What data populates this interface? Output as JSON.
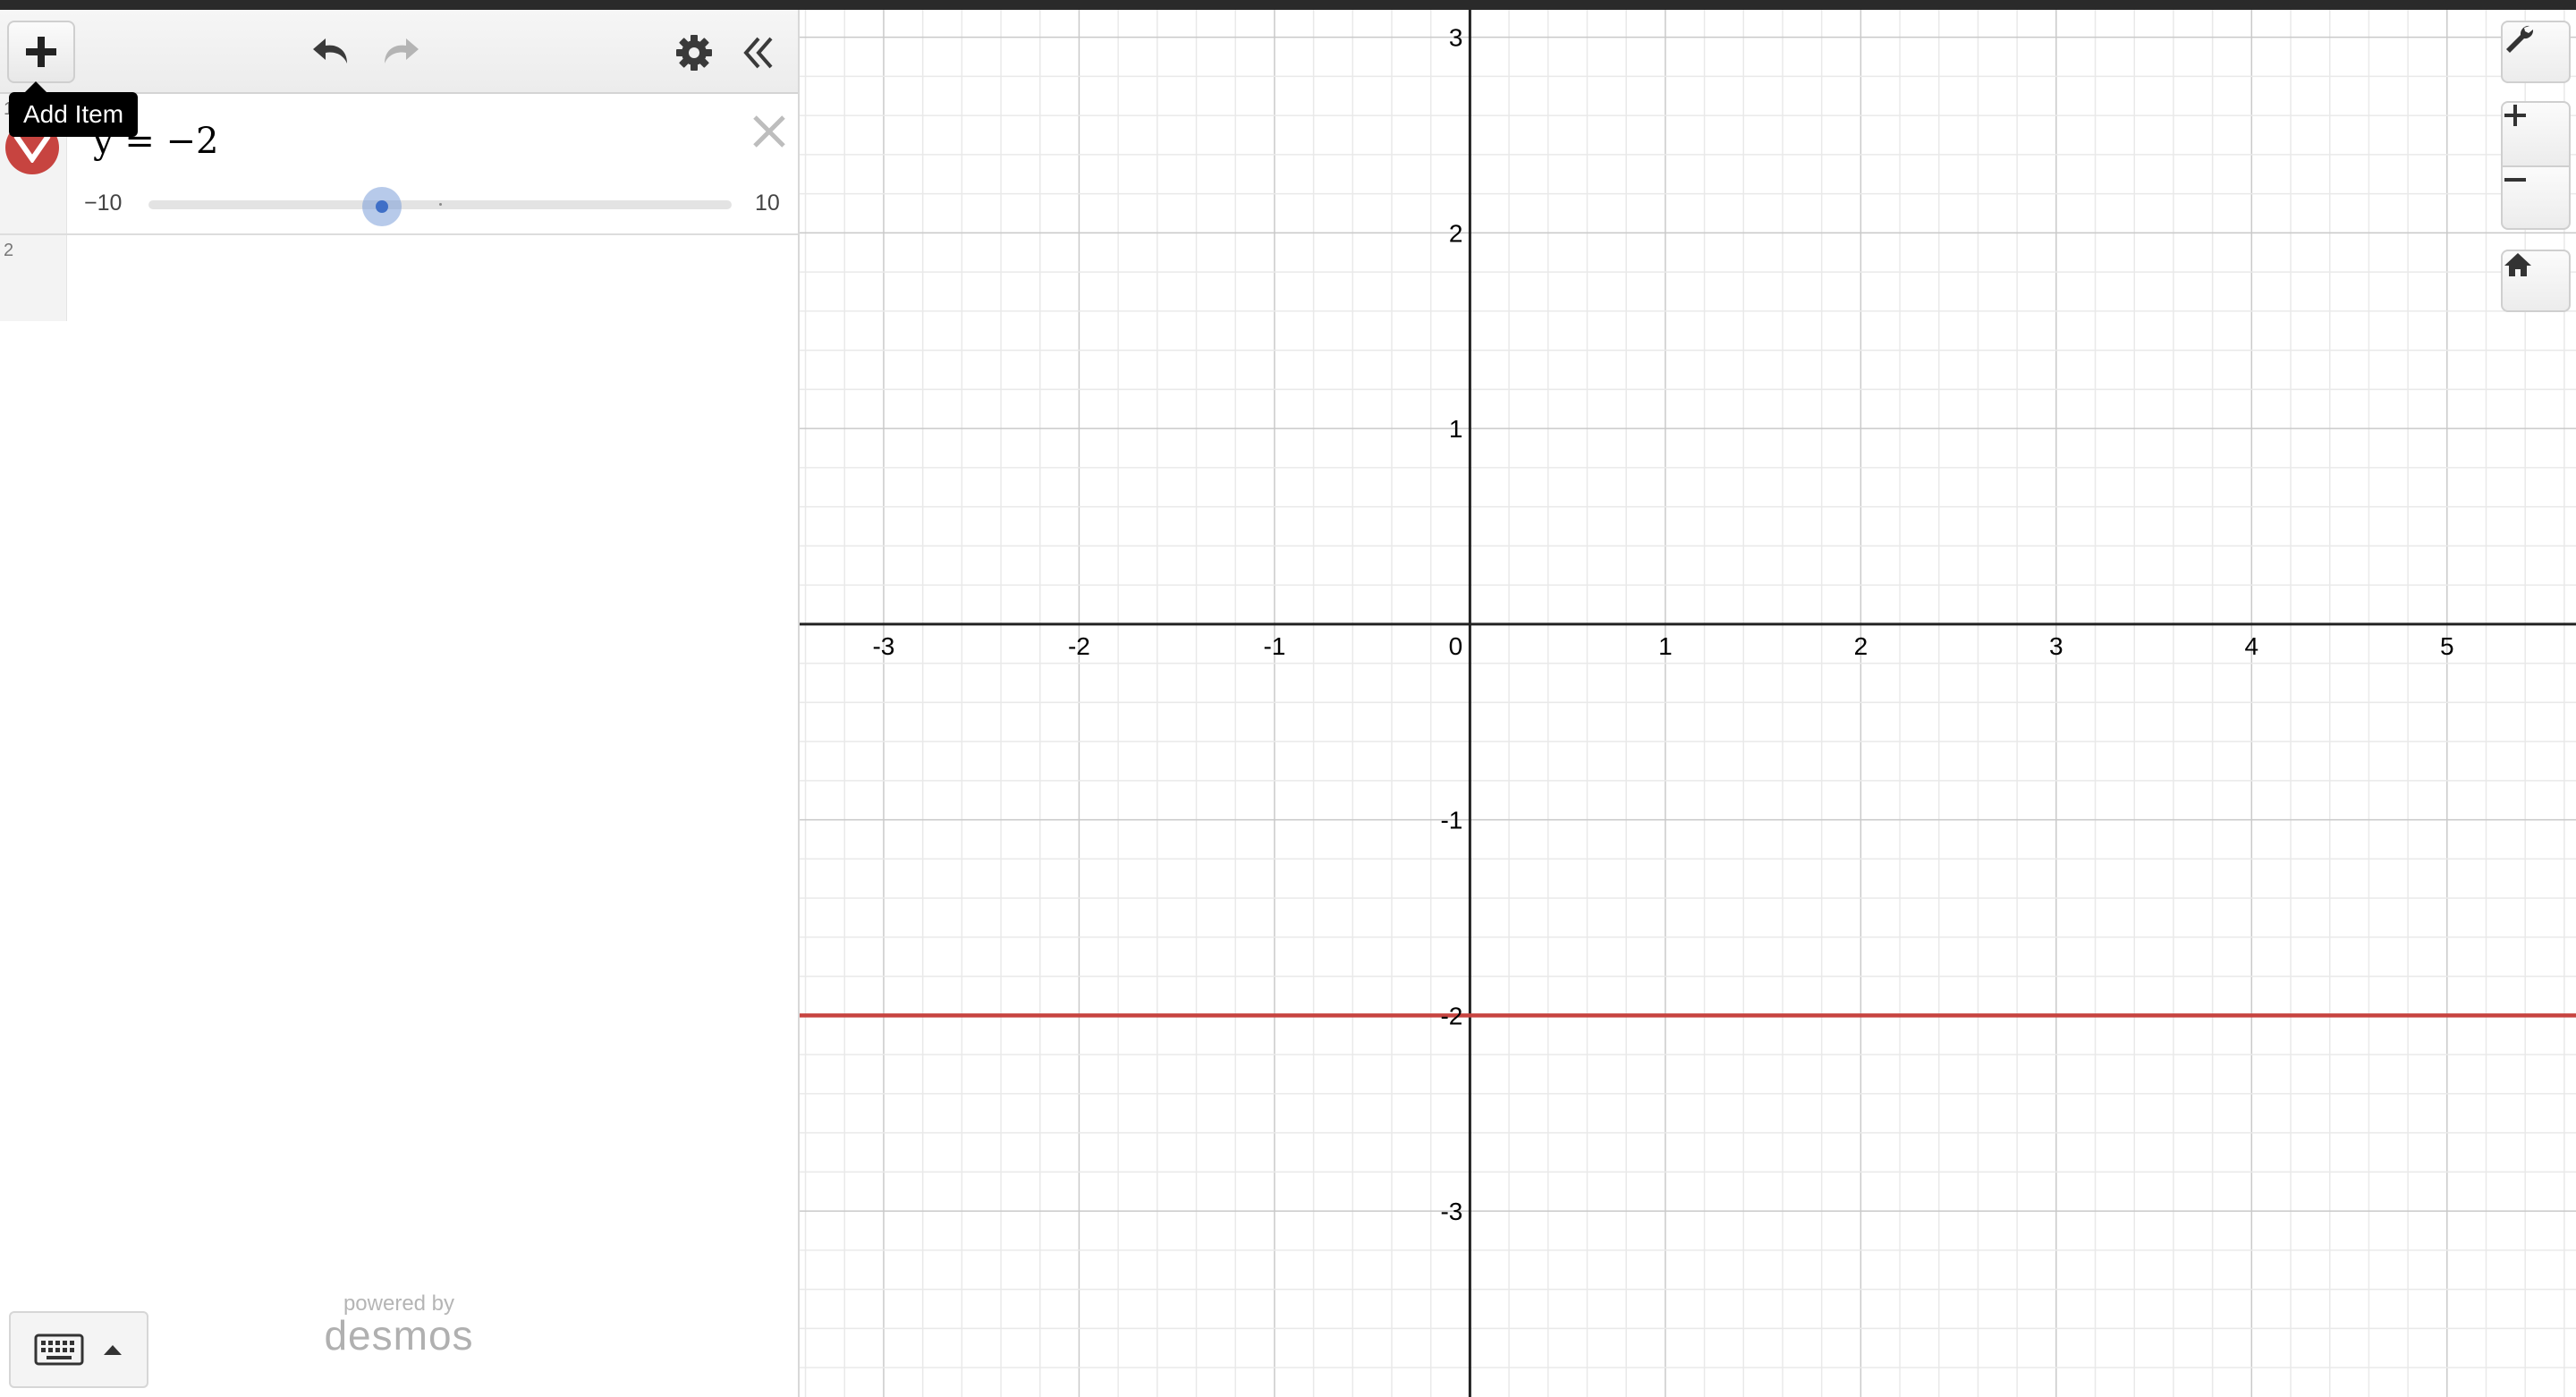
{
  "header": {
    "add_tooltip": "Add Item",
    "icons": [
      "plus-icon",
      "undo-icon",
      "redo-icon",
      "gear-icon",
      "double-chevron-left-icon"
    ]
  },
  "expressions": [
    {
      "index": "1",
      "latex": "y =  −2",
      "color": "#c74440",
      "slider": {
        "min": "−10",
        "max": "10",
        "value": -2,
        "min_value": -10,
        "max_value": 10
      }
    },
    {
      "index": "2",
      "latex": ""
    }
  ],
  "footer": {
    "powered_by": "powered by",
    "brand": "desmos"
  },
  "graph": {
    "x_ticks": [
      "-3",
      "-2",
      "-1",
      "0",
      "1",
      "2",
      "3",
      "4",
      "5"
    ],
    "y_ticks": [
      "3",
      "2",
      "1",
      "-1",
      "-2",
      "-3"
    ],
    "x_range": [
      -3.43,
      5.66
    ],
    "y_range": [
      -3.95,
      3.14
    ],
    "line_y": -2,
    "line_color": "#c74440",
    "axis_color": "#222222",
    "controls": [
      "wrench-icon",
      "zoom-in-icon",
      "zoom-out-icon",
      "home-icon"
    ]
  }
}
